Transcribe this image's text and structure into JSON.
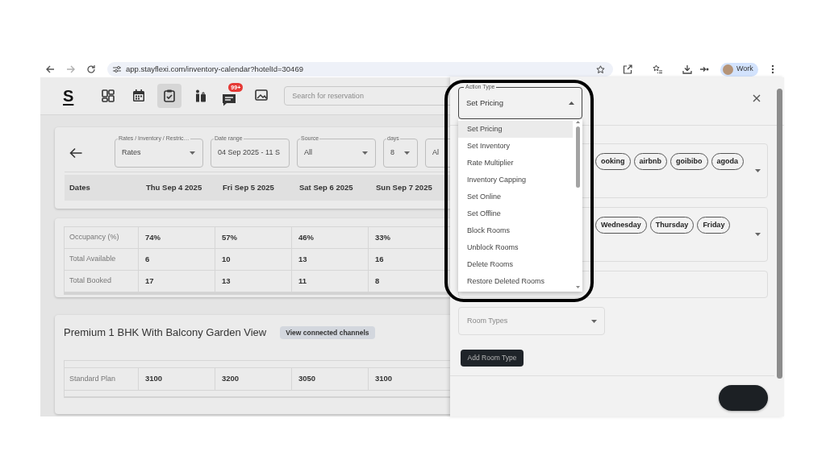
{
  "browser": {
    "url": "app.stayflexi.com/inventory-calendar?hotelId=30469",
    "profile": "Work"
  },
  "app_header": {
    "logo": "S",
    "nav": [
      {
        "kind": "grid",
        "selected": false
      },
      {
        "kind": "calendar",
        "selected": false
      },
      {
        "kind": "clipboard",
        "selected": true
      },
      {
        "kind": "luggage",
        "selected": false
      },
      {
        "kind": "chat",
        "selected": false,
        "badge": "99+"
      },
      {
        "kind": "image",
        "selected": false
      }
    ],
    "search": {
      "placeholder": "Search for reservation"
    }
  },
  "filters": [
    {
      "kind": "select",
      "label": "Rates / Inventory / Restric…",
      "value": "Rates"
    },
    {
      "kind": "text",
      "label": "Date range",
      "value": "04 Sep 2025 - 11 S"
    },
    {
      "kind": "select",
      "label": "Source",
      "value": "All"
    },
    {
      "kind": "select",
      "label": "days",
      "value": "8"
    },
    {
      "kind": "select",
      "value": "Al"
    }
  ],
  "calendar_header": {
    "columns": [
      "Dates",
      "Thu Sep 4 2025",
      "Fri Sep 5 2025",
      "Sat Sep 6 2025",
      "Sun Sep 7 2025"
    ]
  },
  "summary_rows": [
    {
      "label": "Occupancy (%)",
      "cells": [
        "74%",
        "57%",
        "46%",
        "33%"
      ]
    },
    {
      "label": "Total Available",
      "cells": [
        "6",
        "10",
        "13",
        "16"
      ]
    },
    {
      "label": "Total Booked",
      "cells": [
        "17",
        "13",
        "11",
        "8"
      ]
    }
  ],
  "room_type": {
    "title": "Premium 1 BHK With Balcony Garden View",
    "channels_button": "View connected channels",
    "rows": [
      {
        "label": "Standard Plan",
        "cells": [
          "3100",
          "3200",
          "3050",
          "3100"
        ]
      }
    ]
  },
  "bulk_panel": {
    "action_type": {
      "label": "Action Type",
      "value": "Set Pricing",
      "expanded": true,
      "highlighted": true,
      "options": [
        {
          "label": "Set Pricing",
          "selected": true
        },
        {
          "label": "Set Inventory",
          "selected": false
        },
        {
          "label": "Rate Multiplier",
          "selected": false
        },
        {
          "label": "Inventory Capping",
          "selected": false
        },
        {
          "label": "Set Online",
          "selected": false
        },
        {
          "label": "Set Offline",
          "selected": false
        },
        {
          "label": "Block Rooms",
          "selected": false
        },
        {
          "label": "Unblock Rooms",
          "selected": false
        },
        {
          "label": "Delete Rooms",
          "selected": false
        },
        {
          "label": "Restore Deleted Rooms",
          "selected": false
        }
      ]
    },
    "sources": [
      "ooking",
      "airbnb",
      "goibibo",
      "agoda"
    ],
    "days": [
      "Wednesday",
      "Thursday",
      "Friday"
    ],
    "room_types": {
      "placeholder": "Room Types"
    },
    "add_room_type_button": "Add Room Type"
  }
}
